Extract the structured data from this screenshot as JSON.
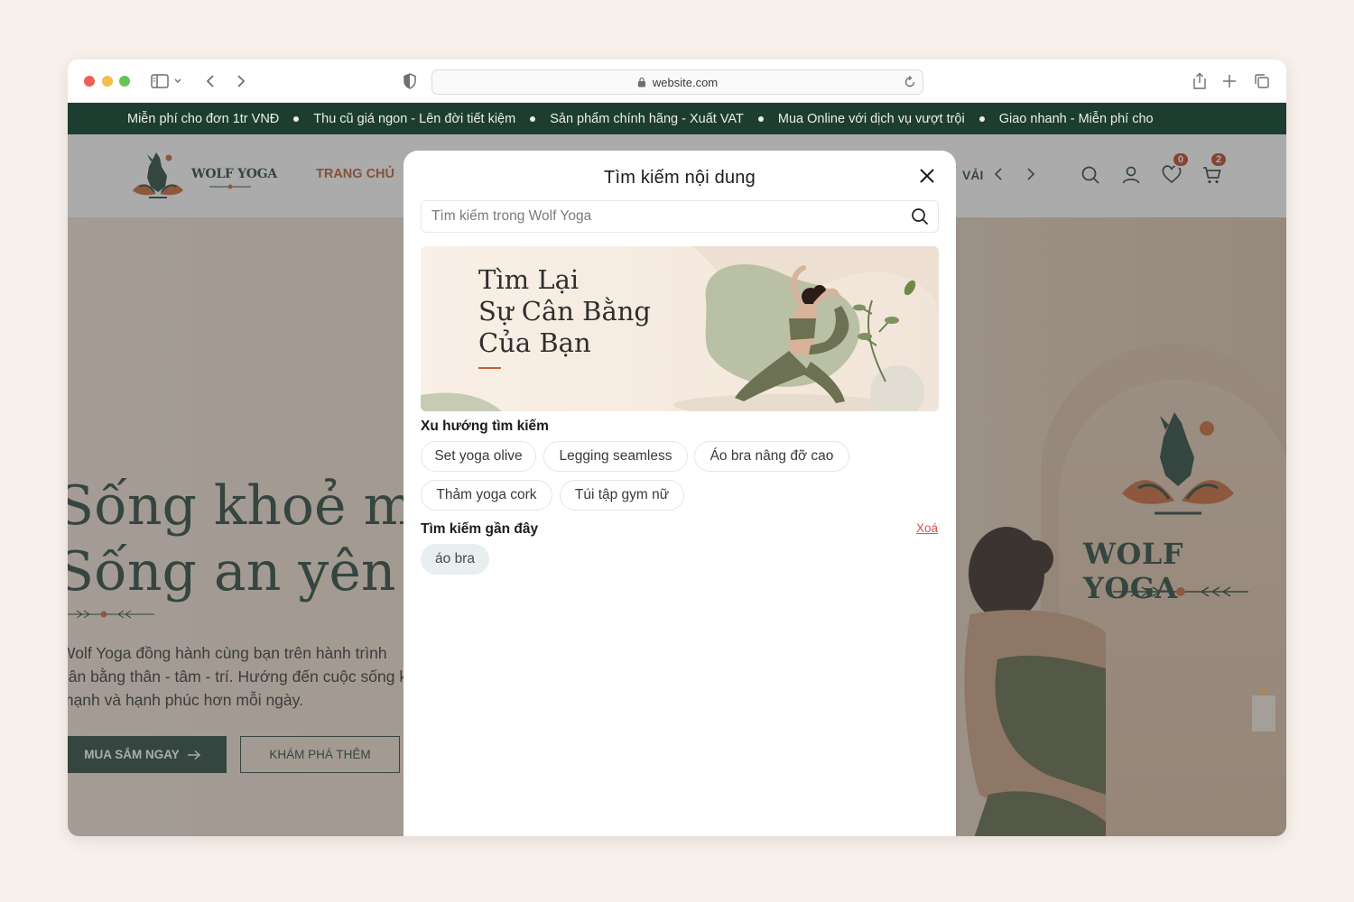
{
  "browser": {
    "url": "website.com"
  },
  "ticker": {
    "items": [
      "Miễn phí cho đơn 1tr VNĐ",
      "Thu cũ giá ngon - Lên đời tiết kiệm",
      "Sản phẩm chính hãng - Xuất VAT",
      "Mua Online với dịch vụ vượt trội",
      "Giao nhanh - Miễn phí cho"
    ]
  },
  "header": {
    "logo_text": "WOLF YOGA",
    "nav_home": "TRANG CHỦ",
    "nav_partial": "VẢI",
    "wishlist_count": "0",
    "cart_count": "2"
  },
  "hero": {
    "title_line1": "Sống khoẻ mạnh",
    "title_line2": "Sống an yên",
    "desc_line1": "Wolf Yoga đồng hành cùng bạn trên hành trình",
    "desc_line2": "cân bằng thân - tâm - trí. Hướng đến cuộc sống khoẻ",
    "desc_line3": "mạnh và hạnh phúc hơn mỗi ngày.",
    "shop_button": "MUA SẮM NGAY",
    "explore_button": "KHÁM PHÁ THÊM",
    "wall_brand": "WOLF YOGA"
  },
  "search_modal": {
    "title": "Tìm kiếm nội dung",
    "placeholder": "Tìm kiếm trong Wolf Yoga",
    "banner_line1": "Tìm Lại",
    "banner_line2": "Sự Cân Bằng",
    "banner_line3": "Của Bạn",
    "trending_label": "Xu hướng tìm kiếm",
    "trending": [
      "Set yoga olive",
      "Legging seamless",
      "Áo bra nâng đỡ cao",
      "Thảm yoga cork",
      "Túi tập gym nữ"
    ],
    "recent_label": "Tìm kiếm gần đây",
    "clear_label": "Xoá",
    "recent": [
      "áo bra"
    ]
  },
  "colors": {
    "brand_green": "#1e3d31",
    "accent_orange": "#b5552b",
    "badge_red": "#b83a1e",
    "clear_red": "#d94d4d"
  }
}
